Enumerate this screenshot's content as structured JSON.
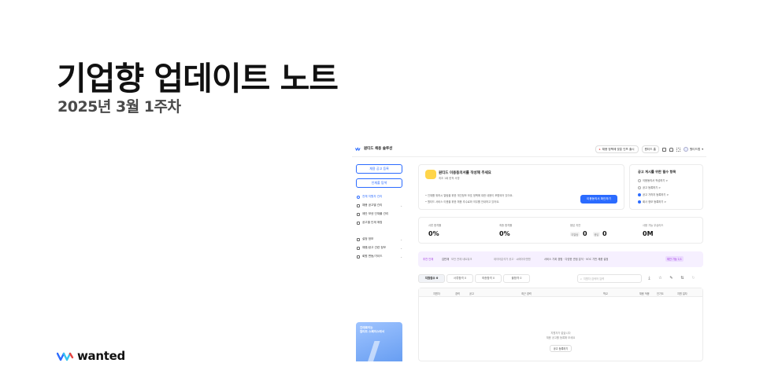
{
  "hero": {
    "title": "기업향 업데이트 노트",
    "subtitle": "2025년 3월 1주차"
  },
  "brand": {
    "name": "wanted"
  },
  "colors": {
    "accent": "#2b6bff",
    "banner_accent": "#a33ae0"
  },
  "app": {
    "title": "원티드 채용 솔루션",
    "top_actions": {
      "notice": "채용 정책에 맞춘 인프 출시",
      "company": "원티드 홈",
      "user": "원티드랩"
    },
    "sidebar": {
      "post_button": "채용 공고 등록",
      "search_button": "인재풀 탐색",
      "items": [
        {
          "label": "전체 지원자 관리"
        },
        {
          "label": "채용 공고별 관리"
        },
        {
          "label": "제안 보낸 인재풀 관리"
        },
        {
          "label": "공고별 인재 매칭"
        },
        {
          "label": "설정 정보"
        },
        {
          "label": "채용/공고 관련 정보"
        },
        {
          "label": "회원 변동/가이드"
        }
      ],
      "promo": {
        "line1": "긴데로이는",
        "line2": "원티드 스페이스에서"
      }
    },
    "welcome": {
      "heading": "원티드 이용동의서를 작성해 주세요",
      "sub": "최초 1회 한적 서명",
      "line1": "• 인재를 위하시 열람을 위한 개인정보 보호 정책에 대한 내용이 포함되어 있어요.",
      "line2": "• 원티드 서비스 이용을 위한 채용 추수료와 의무를 안내하고 있어요.",
      "cta": "이용동의서 확인하기"
    },
    "checklist": {
      "heading": "공고 게시를 위한 필수 항목",
      "items": [
        {
          "label": "이용동의서 작성하기 >",
          "done": false
        },
        {
          "label": "공고 등록하기 >",
          "done": false
        },
        {
          "label": "공고 가까지 등록하기 >",
          "done": true
        },
        {
          "label": "회사 정보 등록하기 >",
          "done": true
        }
      ]
    },
    "stats": [
      {
        "label": "서류 합격률",
        "value": "0%"
      },
      {
        "label": "최종 합격률",
        "value": "0%"
      },
      {
        "label": "응답 지연",
        "mini1": "미열람",
        "value1": "0",
        "mini2": "응답",
        "value2": "0"
      },
      {
        "label": "사용 가능 무상리드",
        "value": "0M"
      }
    ],
    "banner": {
      "label": "추천 인재",
      "name": "김민재",
      "role": "보안 관제 네트워크",
      "desc": "데이터분석가 공고 · 씨에이아엔엔",
      "detail": "서비스 기획 경험 · 다양한 관점 분석 · VOC 기반 제품 설정",
      "tag": "제안 가능 1/1"
    },
    "tabs": [
      {
        "label": "지원접수 0"
      },
      {
        "label": "서류합격 0"
      },
      {
        "label": "최종합격 0"
      },
      {
        "label": "불합격 0"
      }
    ],
    "search": {
      "placeholder": "지원자 검색어 입력"
    },
    "table": {
      "headers": [
        "지원자",
        "경력",
        "공고",
        "최근 경력",
        "학교",
        "채용 적용",
        "인기도",
        "지원 일자"
      ],
      "empty_line1": "지원자가 없습니다",
      "empty_line2": "채용 공고를 등록해 보세요",
      "empty_button": "공고 등록하기"
    }
  }
}
